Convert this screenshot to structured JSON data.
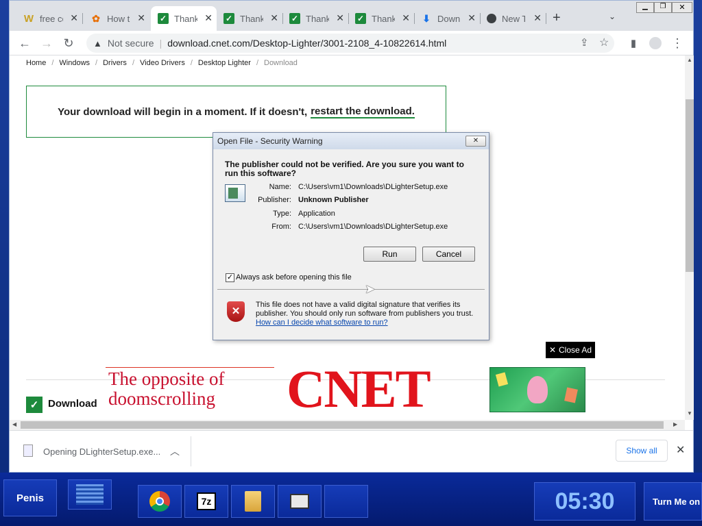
{
  "tabs": [
    {
      "label": "free co",
      "icon": "w-icon"
    },
    {
      "label": "How t",
      "icon": "puzzle-icon"
    },
    {
      "label": "Thank",
      "icon": "cnet-icon",
      "active": true
    },
    {
      "label": "Thank",
      "icon": "cnet-icon"
    },
    {
      "label": "Thank",
      "icon": "cnet-icon"
    },
    {
      "label": "Thank",
      "icon": "cnet-icon"
    },
    {
      "label": "Down",
      "icon": "download-icon"
    },
    {
      "label": "New T",
      "icon": "chrome-icon"
    }
  ],
  "toolbar": {
    "security_label": "Not secure",
    "url": "download.cnet.com/Desktop-Lighter/3001-2108_4-10822614.html"
  },
  "breadcrumb": [
    "Home",
    "Windows",
    "Drivers",
    "Video Drivers",
    "Desktop Lighter",
    "Download"
  ],
  "download_box": {
    "text": "Your download will begin in a moment. If it doesn't,",
    "link": "restart the download."
  },
  "ad": {
    "close_label": "Close Ad",
    "tagline_1": "The opposite of",
    "tagline_2": "doomscrolling",
    "brand": "CNET",
    "partial_heading": "Download"
  },
  "dialog": {
    "title": "Open File - Security Warning",
    "question": "The publisher could not be verified.  Are you sure you want to run this software?",
    "fields": [
      {
        "label": "Name:",
        "value": "C:\\Users\\vm1\\Downloads\\DLighterSetup.exe",
        "bold": false
      },
      {
        "label": "Publisher:",
        "value": "Unknown Publisher",
        "bold": true
      },
      {
        "label": "Type:",
        "value": "Application",
        "bold": false
      },
      {
        "label": "From:",
        "value": "C:\\Users\\vm1\\Downloads\\DLighterSetup.exe",
        "bold": false
      }
    ],
    "run_label": "Run",
    "cancel_label": "Cancel",
    "checkbox_label": "Always ask before opening this file",
    "checkbox_checked": true,
    "warning_text": "This file does not have a valid digital signature that verifies its publisher.  You should only run software from publishers you trust.",
    "help_link": "How can I decide what software to run?"
  },
  "download_bar": {
    "item_label": "Opening DLighterSetup.exe...",
    "show_all_label": "Show all"
  },
  "taskbar": {
    "start_label": "Penis",
    "clock": "05:30",
    "right_button": "Turn Me on"
  }
}
